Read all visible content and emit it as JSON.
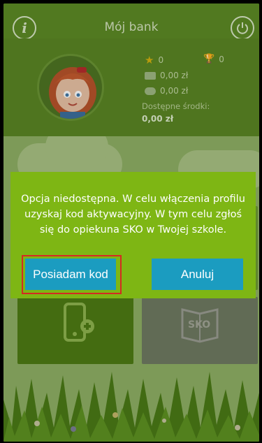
{
  "header": {
    "title": "Mój bank"
  },
  "profile": {
    "stars": "0",
    "trophies": "0",
    "money_1": "0,00 zł",
    "money_2": "0,00 zł",
    "available_label": "Dostępne środki:",
    "available_value": "0,00 zł"
  },
  "tiles": {
    "sko_label": "SKO"
  },
  "dialog": {
    "message": "Opcja niedostępna. W celu włączenia profilu uzyskaj kod aktywacyjny. W tym celu zgłoś się do opiekuna SKO w Twojej szkole.",
    "primary_label": "Posiadam kod",
    "secondary_label": "Anuluj"
  },
  "colors": {
    "header_green": "#5d8a25",
    "dialog_green": "#7eb614",
    "button_blue": "#1b9cc0",
    "highlight_red": "#d52a22"
  }
}
